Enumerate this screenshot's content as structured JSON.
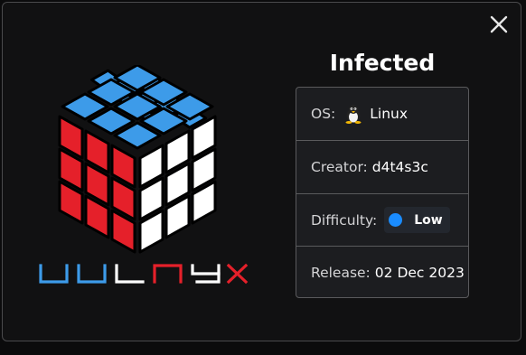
{
  "machine": {
    "title": "Infected",
    "os_label": "OS:",
    "os_value": "Linux",
    "os_icon": "tux-penguin-icon",
    "creator_label": "Creator:",
    "creator_value": "d4t4s3c",
    "difficulty_label": "Difficulty:",
    "difficulty_value": "Low",
    "difficulty_color": "#1a8cff",
    "release_label": "Release:",
    "release_value": "02 Dec 2023"
  },
  "logo": {
    "wordmark": "VULNYX",
    "colors": {
      "cube_top": "#3d9be9",
      "cube_left": "#e5202a",
      "cube_right": "#ffffff",
      "letters_blue": "#3d9be9",
      "letters_white": "#ffffff",
      "letters_red": "#e5202a"
    }
  },
  "actions": {
    "close_icon": "close-icon"
  }
}
